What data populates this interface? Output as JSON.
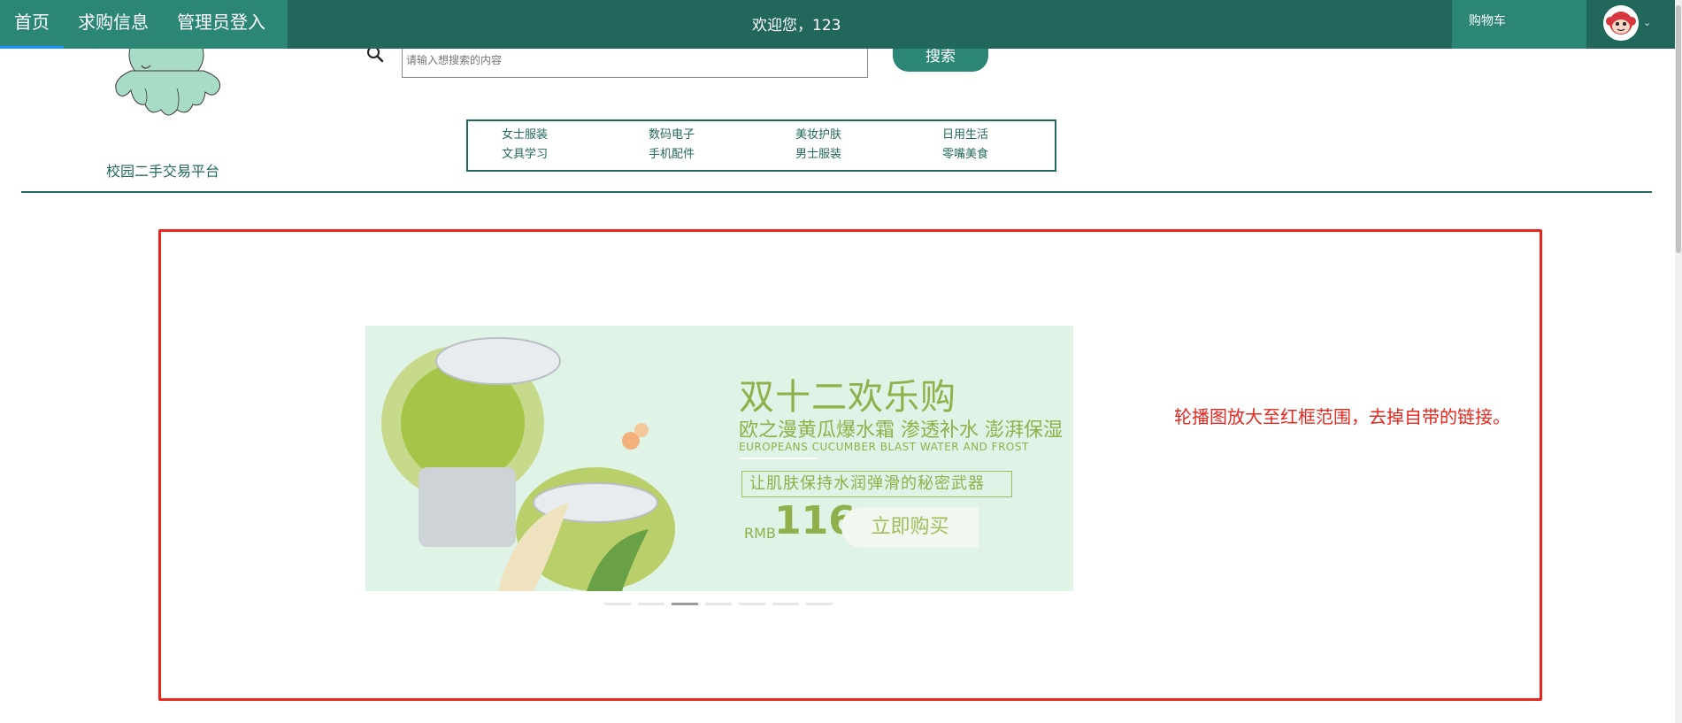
{
  "nav": {
    "items": [
      {
        "label": "首页",
        "active": true
      },
      {
        "label": "求购信息",
        "active": false
      },
      {
        "label": "管理员登入",
        "active": false
      }
    ],
    "welcome": "欢迎您，123",
    "cart_label": "购物车"
  },
  "header": {
    "site_name": "校园二手交易平台",
    "search_placeholder": "请输入想搜索的内容",
    "search_button": "搜索"
  },
  "categories": [
    "女士服装",
    "数码电子",
    "美妆护肤",
    "日用生活",
    "文具学习",
    "手机配件",
    "男士服装",
    "零嘴美食"
  ],
  "banner": {
    "title": "双十二欢乐购",
    "subtitle": "欧之漫黄瓜爆水霜 渗透补水 澎湃保湿",
    "english": "EUROPEANS CUCUMBER BLAST WATER AND FROST",
    "slogan": "让肌肤保持水润弹滑的秘密武器",
    "currency": "RMB",
    "price": "116",
    "buy_label": "立即购买",
    "slide_count": 7,
    "active_slide": 3
  },
  "annotation": "轮播图放大至红框范围，去掉自带的链接。",
  "colors": {
    "nav_dark": "#22675c",
    "nav_light": "#2b8676",
    "brand_green": "#22675c",
    "annotation_red": "#e8261e",
    "banner_bg": "#dff3e6",
    "banner_text": "#8fb04a"
  }
}
